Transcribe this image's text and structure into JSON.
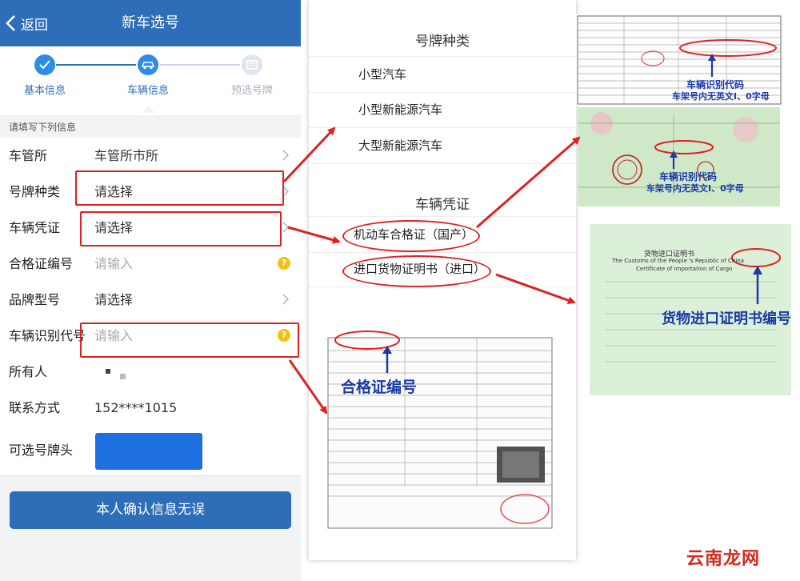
{
  "header": {
    "back_label": "返回",
    "title": "新车选号"
  },
  "steps": [
    {
      "label": "基本信息",
      "state": "done"
    },
    {
      "label": "车辆信息",
      "state": "active"
    },
    {
      "label": "预选号牌",
      "state": "pending"
    }
  ],
  "form": {
    "hint": "请填写下列信息",
    "rows": [
      {
        "label": "车管所",
        "value": "车管所市所"
      },
      {
        "label": "号牌种类",
        "value": "请选择"
      },
      {
        "label": "车辆凭证",
        "value": "请选择"
      },
      {
        "label": "合格证编号",
        "value": "请输入"
      },
      {
        "label": "品牌型号",
        "value": "请选择"
      },
      {
        "label": "车辆识别代号",
        "value": "请输入"
      },
      {
        "label": "所有人",
        "value": ""
      },
      {
        "label": "联系方式",
        "value": "152****1015"
      },
      {
        "label": "可选号牌头",
        "value": ""
      }
    ],
    "confirm_label": "本人确认信息无误"
  },
  "plate_types": {
    "title": "号牌种类",
    "options": [
      "小型汽车",
      "小型新能源汽车",
      "大型新能源汽车"
    ]
  },
  "vehicle_credentials": {
    "title": "车辆凭证",
    "options": [
      "机动车合格证（国产）",
      "进口货物证明书（进口）"
    ]
  },
  "annotations": {
    "vin_code": "车辆识别代码",
    "vin_note": "车架号内无英文I、0字母",
    "cert_no": "合格证编号",
    "import_cert_no": "货物进口证明书编号"
  },
  "import_certificate": {
    "title_cn": "货物进口证明书",
    "title_en": "The Customs of the People 's Republic of China",
    "subtitle_en": "Certificate of Importation of Cargo"
  },
  "watermark": "云南龙网",
  "colors": {
    "brand_blue": "#2e6db7",
    "highlight_red": "#e02020",
    "annotation_blue": "#1a3aa8",
    "plate_blue": "#1e6fe0"
  }
}
